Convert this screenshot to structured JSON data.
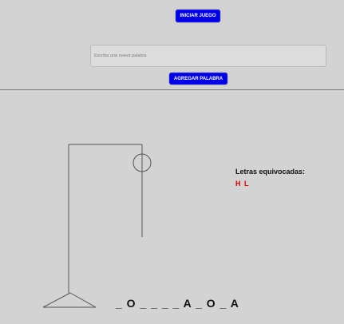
{
  "start_button_label": "INICIAR JUEGO",
  "word_input": {
    "placeholder": "Escriba una nueva palabra",
    "value": ""
  },
  "add_word_button_label": "AGREGAR PALABRA",
  "wrong_letters_label": "Letras equivocadas:",
  "wrong_letters": "H L",
  "word_display": "_ O _ _ _ _ A _ O _ A",
  "colors": {
    "background": "#d3d3d3",
    "button": "#0000e6",
    "wrong_letters": "#e00000"
  },
  "hangman_stage": "head"
}
